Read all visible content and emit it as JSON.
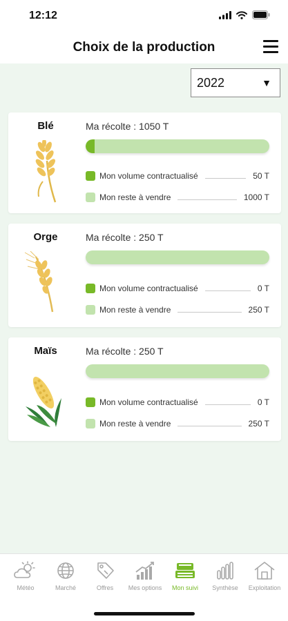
{
  "status": {
    "time": "12:12"
  },
  "header": {
    "title": "Choix de la production"
  },
  "year_selector": {
    "value": "2022"
  },
  "legend": {
    "contracted": "Mon volume contractualisé",
    "remaining": "Mon reste à vendre"
  },
  "crops": [
    {
      "name": "Blé",
      "harvest": "Ma récolte : 1050 T",
      "contracted_value": "50 T",
      "remaining_value": "1000 T",
      "contracted_fraction": 0.048
    },
    {
      "name": "Orge",
      "harvest": "Ma récolte : 250 T",
      "contracted_value": "0 T",
      "remaining_value": "250 T",
      "contracted_fraction": 0
    },
    {
      "name": "Maïs",
      "harvest": "Ma récolte : 250 T",
      "contracted_value": "0 T",
      "remaining_value": "250 T",
      "contracted_fraction": 0
    }
  ],
  "tabs": [
    {
      "label": "Météo",
      "icon": "weather-icon"
    },
    {
      "label": "Marché",
      "icon": "globe-icon"
    },
    {
      "label": "Offres",
      "icon": "tag-icon"
    },
    {
      "label": "Mes options",
      "icon": "growth-chart-icon"
    },
    {
      "label": "Mon suivi",
      "icon": "tractor-icon",
      "active": true
    },
    {
      "label": "Synthèse",
      "icon": "bar-chart-icon"
    },
    {
      "label": "Exploitation",
      "icon": "farm-house-icon"
    }
  ],
  "colors": {
    "accent": "#78b928",
    "accent_light": "#c2e3ae",
    "background": "#eef6ef"
  }
}
